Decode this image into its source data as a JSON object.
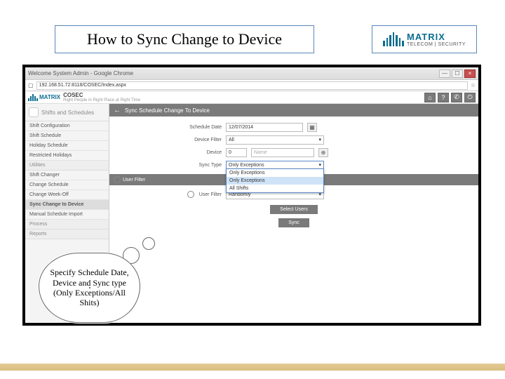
{
  "slide": {
    "title": "How to Sync Change to Device",
    "logo_brand": "MATRIX",
    "logo_sub": "TELECOM | SECURITY"
  },
  "browser": {
    "window_title": "Welcome System Admin - Google Chrome",
    "url": "192.168.51.72:8118/COSEC/Index.aspx",
    "min": "—",
    "max": "☐",
    "close": "×"
  },
  "app": {
    "brand": "MATRIX",
    "product": "COSEC",
    "tagline": "Right People in Right Place at Right Time",
    "top_icons": {
      "home": "⌂",
      "help": "?",
      "phone": "✆",
      "power": "⏻"
    }
  },
  "sidebar": {
    "section": "Shifts and Schedules",
    "items": [
      {
        "label": "Shift Configuration"
      },
      {
        "label": "Shift Schedule"
      },
      {
        "label": "Holiday Schedule"
      },
      {
        "label": "Restricted Holidays"
      }
    ],
    "cat_util": "Utilities",
    "util_items": [
      {
        "label": "Shift Changer"
      },
      {
        "label": "Change Schedule"
      },
      {
        "label": "Change Week-Off"
      },
      {
        "label": "Sync Change to Device",
        "active": true
      },
      {
        "label": "Manual Schedule Import"
      }
    ],
    "cat_proc": "Process",
    "cat_rep": "Reports"
  },
  "panel": {
    "title": "Sync Schedule Change To Device",
    "back": "←",
    "schedule_date_label": "Schedule Date",
    "schedule_date_value": "12/07/2014",
    "device_filter_label": "Device Filter",
    "device_filter_value": "All",
    "device_label": "Device",
    "device_id": "0",
    "device_name": "Name",
    "sync_type_label": "Sync Type",
    "sync_type_value": "Only Exceptions",
    "sync_type_options": [
      "Only Exceptions",
      "Only Exceptions",
      "All Shifts"
    ],
    "user_filter_section": "User Filter",
    "user_filter_label": "User Filter",
    "user_filter_value": "Randomly",
    "radio_blank": "",
    "select_users_btn": "Select Users",
    "sync_btn": "Sync"
  },
  "callout": {
    "text": "Specify Schedule Date, Device and Sync type (Only Exceptions/All Shits)"
  }
}
